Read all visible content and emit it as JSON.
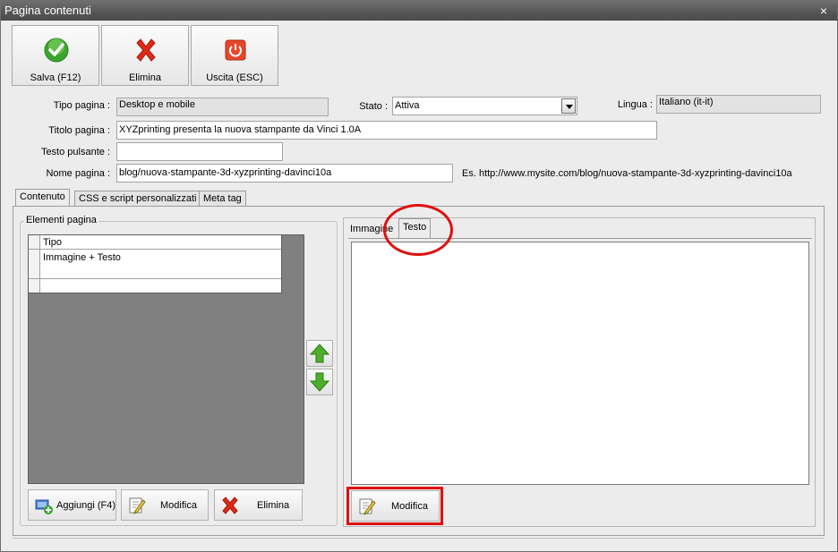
{
  "window": {
    "title": "Pagina contenuti",
    "close_glyph": "×"
  },
  "toolbar": {
    "save": {
      "label": "Salva (F12)",
      "icon": "check-circle-icon",
      "color": "#3aa52c"
    },
    "delete": {
      "label": "Elimina",
      "icon": "red-x-icon",
      "color": "#e02a17"
    },
    "exit": {
      "label": "Uscita (ESC)",
      "icon": "power-icon",
      "color": "#e5472b"
    }
  },
  "form": {
    "tipo_pagina": {
      "label": "Tipo pagina :",
      "value": "Desktop e mobile"
    },
    "stato": {
      "label": "Stato :",
      "value": "Attiva"
    },
    "lingua": {
      "label": "Lingua :",
      "value": "Italiano (it-it)"
    },
    "titolo_pagina": {
      "label": "Titolo pagina :",
      "value": "XYZprinting presenta la nuova stampante da Vinci 1.0A"
    },
    "testo_pulsante": {
      "label": "Testo pulsante :",
      "value": ""
    },
    "nome_pagina": {
      "label": "Nome pagina :",
      "value": "blog/nuova-stampante-3d-xyzprinting-davinci10a",
      "example": "Es. http://www.mysite.com/blog/nuova-stampante-3d-xyzprinting-davinci10a"
    }
  },
  "tabs": [
    {
      "label": "Contenuto",
      "active": true
    },
    {
      "label": "CSS e script personalizzati",
      "active": false
    },
    {
      "label": "Meta tag",
      "active": false
    }
  ],
  "elementi": {
    "group_title": "Elementi pagina",
    "column_header": "Tipo",
    "rows": [
      "Immagine + Testo",
      ""
    ]
  },
  "left_buttons": {
    "add": {
      "label": "Aggiungi (F4)",
      "icon": "add-item-icon"
    },
    "edit": {
      "label": "Modifica",
      "icon": "edit-pencil-icon"
    },
    "delete": {
      "label": "Elimina",
      "icon": "red-x-icon"
    }
  },
  "move": {
    "up_icon": "arrow-up-icon",
    "down_icon": "arrow-down-icon",
    "color": "#4cae2a"
  },
  "right_tabs": [
    {
      "label": "Immagine",
      "active": false
    },
    {
      "label": "Testo",
      "active": true
    }
  ],
  "right_buttons": {
    "edit": {
      "label": "Modifica",
      "icon": "edit-pencil-icon"
    }
  },
  "colors": {
    "highlight": "#e01010",
    "titlebar": "#555555",
    "grid_bg": "#808080"
  }
}
